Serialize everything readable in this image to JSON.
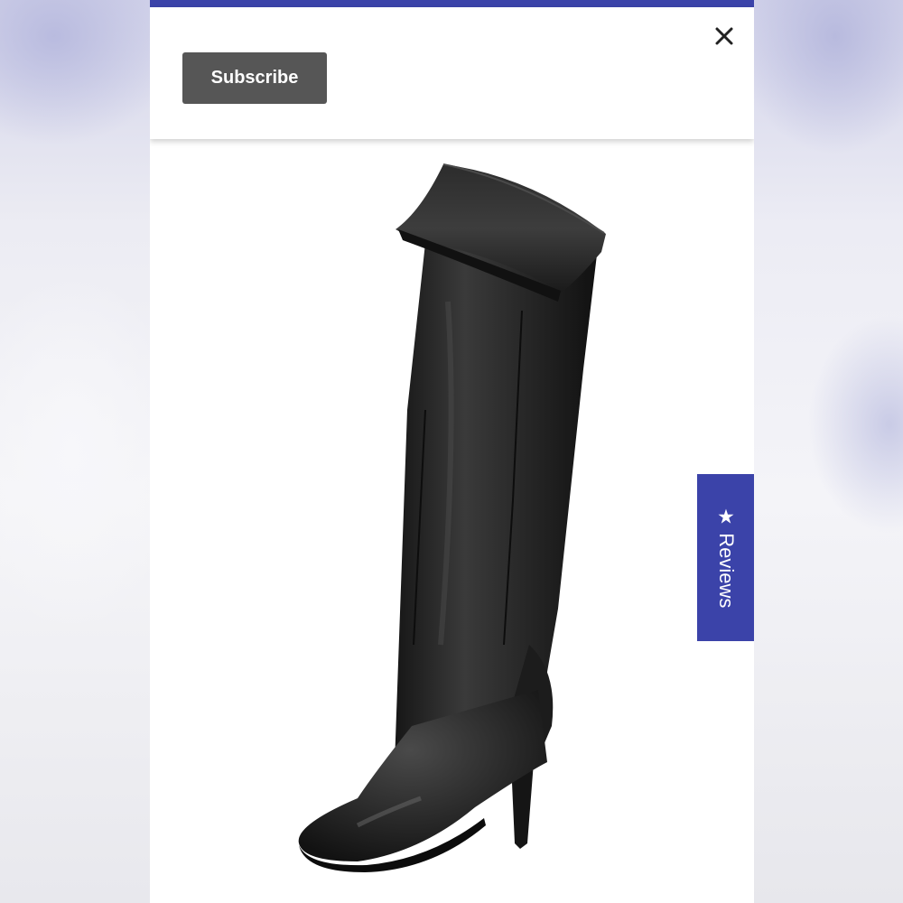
{
  "banner": {
    "subscribe_label": "Subscribe"
  },
  "close_icon": "close-icon",
  "product": {
    "image_subject": "boot-image"
  },
  "reviews_tab": {
    "star_glyph": "★",
    "label": "Reviews"
  },
  "colors": {
    "accent": "#3b43a9",
    "button_bg": "#565656"
  }
}
